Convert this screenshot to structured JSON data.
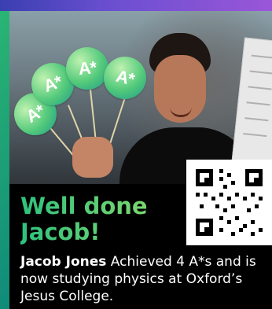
{
  "headline": {
    "line1": "Well done",
    "line2": "Jacob!"
  },
  "caption": {
    "name": "Jacob Jones",
    "text": " Achieved 4 A*s and is now studying physics at Oxford’s Jesus College."
  },
  "lollipops": [
    "A*",
    "A*",
    "A*",
    "A*"
  ],
  "colors": {
    "accent_green": "#2ec27e",
    "accent_lime": "#8edb6b",
    "panel": "#000000"
  }
}
